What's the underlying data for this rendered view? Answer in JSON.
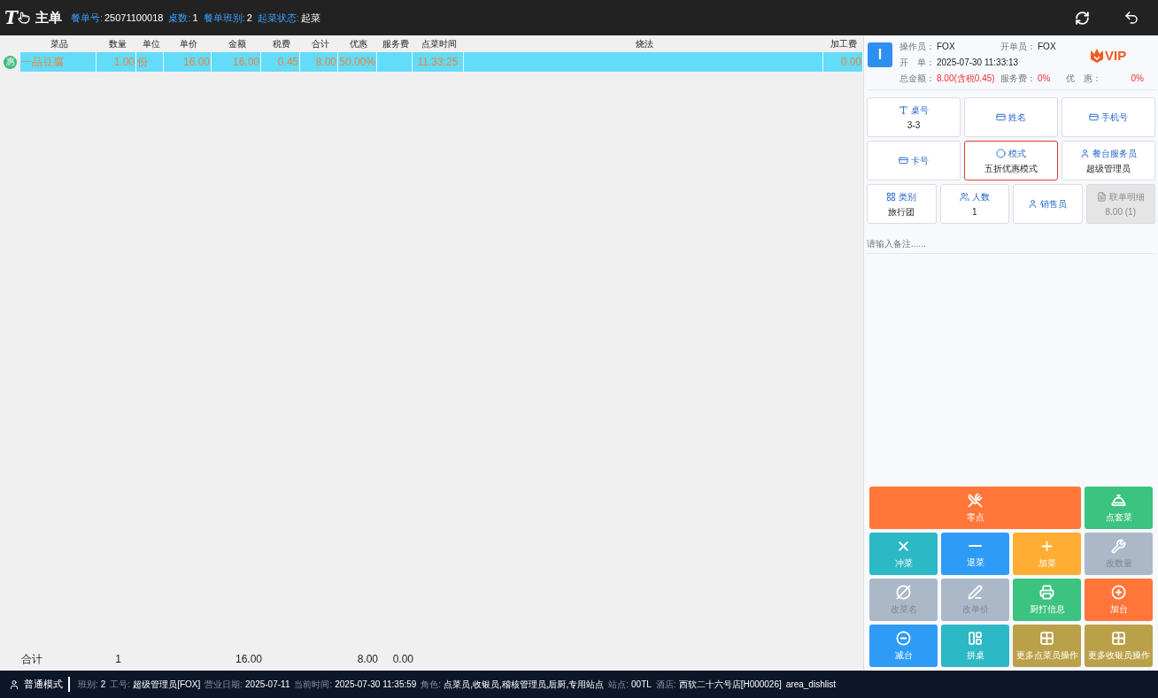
{
  "top_bar": {
    "logo_text": "T",
    "title": "主单",
    "fields": [
      {
        "label": "餐单号:",
        "value": "25071100018"
      },
      {
        "label": "桌数:",
        "value": "1"
      },
      {
        "label": "餐单班别:",
        "value": "2"
      },
      {
        "label": "起菜状态:",
        "value": "起菜"
      }
    ]
  },
  "table": {
    "columns": [
      "菜品",
      "数量",
      "单位",
      "单价",
      "金额",
      "税费",
      "合计",
      "优惠",
      "服务费",
      "点菜时间",
      "烧法",
      "加工费"
    ],
    "rows": [
      {
        "badge": "惠",
        "selected": true,
        "cells": [
          "一品豆腐",
          "1.00",
          "份",
          "16.00",
          "16.00",
          "0.45",
          "8.00",
          "50.00%",
          null,
          "11:33:25",
          null,
          "0.00"
        ]
      }
    ],
    "totals": {
      "label": "合计",
      "quantity": "1",
      "amount": "16.00",
      "discount": "8.00",
      "service_fee": "0.00"
    }
  },
  "order_info": {
    "avatar": "I",
    "vip": "VIP",
    "rows": [
      [
        {
          "label": "操作员：",
          "value": "FOX",
          "emphasis": false
        },
        {
          "label": "开单员：",
          "value": "FOX",
          "emphasis": false
        }
      ],
      [
        {
          "label": "开　单：",
          "value": "2025-07-30 11:33:13",
          "emphasis": false
        }
      ],
      [
        {
          "label": "总金额：",
          "value": "8.00(含税0.45)",
          "emphasis": true
        },
        {
          "label": "服务费：",
          "value": "0%",
          "emphasis": true
        },
        {
          "label": "优　惠：",
          "value": "0%",
          "emphasis": true
        }
      ]
    ]
  },
  "field_rows": [
    [
      {
        "label": "桌号",
        "value": "3-3",
        "selected": false,
        "disabled": false
      },
      {
        "label": "姓名",
        "selected": false,
        "disabled": false
      },
      {
        "label": "手机号",
        "selected": false,
        "disabled": false
      }
    ],
    [
      {
        "label": "卡号",
        "selected": false,
        "disabled": false
      },
      {
        "label": "模式",
        "value": "五折优惠模式",
        "selected": true,
        "disabled": false
      },
      {
        "label": "餐台服务员",
        "value": "超级管理员",
        "selected": false,
        "disabled": false
      }
    ],
    [
      {
        "label": "类别",
        "value": "旅行团",
        "selected": false,
        "disabled": false
      },
      {
        "label": "人数",
        "value": "1",
        "selected": false,
        "disabled": false
      },
      {
        "label": "销售员",
        "selected": false,
        "disabled": false
      },
      {
        "label": "联单明细",
        "value": "8.00 (1)",
        "selected": false,
        "disabled": true
      }
    ]
  ],
  "remark": {
    "placeholder": "请输入备注......"
  },
  "actions": [
    {
      "label": "零点",
      "color": "#ff7638",
      "disabled": false
    },
    {
      "label": "点套菜",
      "color": "#3cc37f",
      "disabled": false
    },
    {
      "label": "冲菜",
      "color": "#2cb9c5",
      "disabled": false
    },
    {
      "label": "退菜",
      "color": "#2e9bf6",
      "disabled": false
    },
    {
      "label": "加菜",
      "color": "#ffad33",
      "disabled": false
    },
    {
      "label": "改数量",
      "color": "#abb8c8",
      "disabled": true
    },
    {
      "label": "改菜名",
      "color": "#abb8c8",
      "disabled": true
    },
    {
      "label": "改单价",
      "color": "#abb8c8",
      "disabled": true
    },
    {
      "label": "厨打信息",
      "color": "#3cc37f",
      "disabled": false
    },
    {
      "label": "加台",
      "color": "#ff7638",
      "disabled": false
    },
    {
      "label": "减台",
      "color": "#2e9bf6",
      "disabled": false
    },
    {
      "label": "拼桌",
      "color": "#2cb9c5",
      "disabled": false
    },
    {
      "label": "更多点菜员操作",
      "color": "#bba04a",
      "disabled": false
    },
    {
      "label": "更多收银员操作",
      "color": "#bba04a",
      "disabled": false
    }
  ],
  "status_bar": {
    "mode": "普通模式",
    "fields": [
      {
        "label": "班别:",
        "value": "2"
      },
      {
        "label": "工号:",
        "value": "超级管理员[FOX]"
      },
      {
        "label": "营业日期:",
        "value": "2025-07-11"
      },
      {
        "label": "当前时间:",
        "value": "2025-07-30 11:35:59"
      },
      {
        "label": "角色:",
        "value": "点菜员,收银员,稽核管理员,后厨,专用站点"
      },
      {
        "label": "站点:",
        "value": "00TL"
      },
      {
        "label": "酒店:",
        "value": "西软二十六号店[H000026]"
      }
    ],
    "extra": "area_dishlist"
  }
}
